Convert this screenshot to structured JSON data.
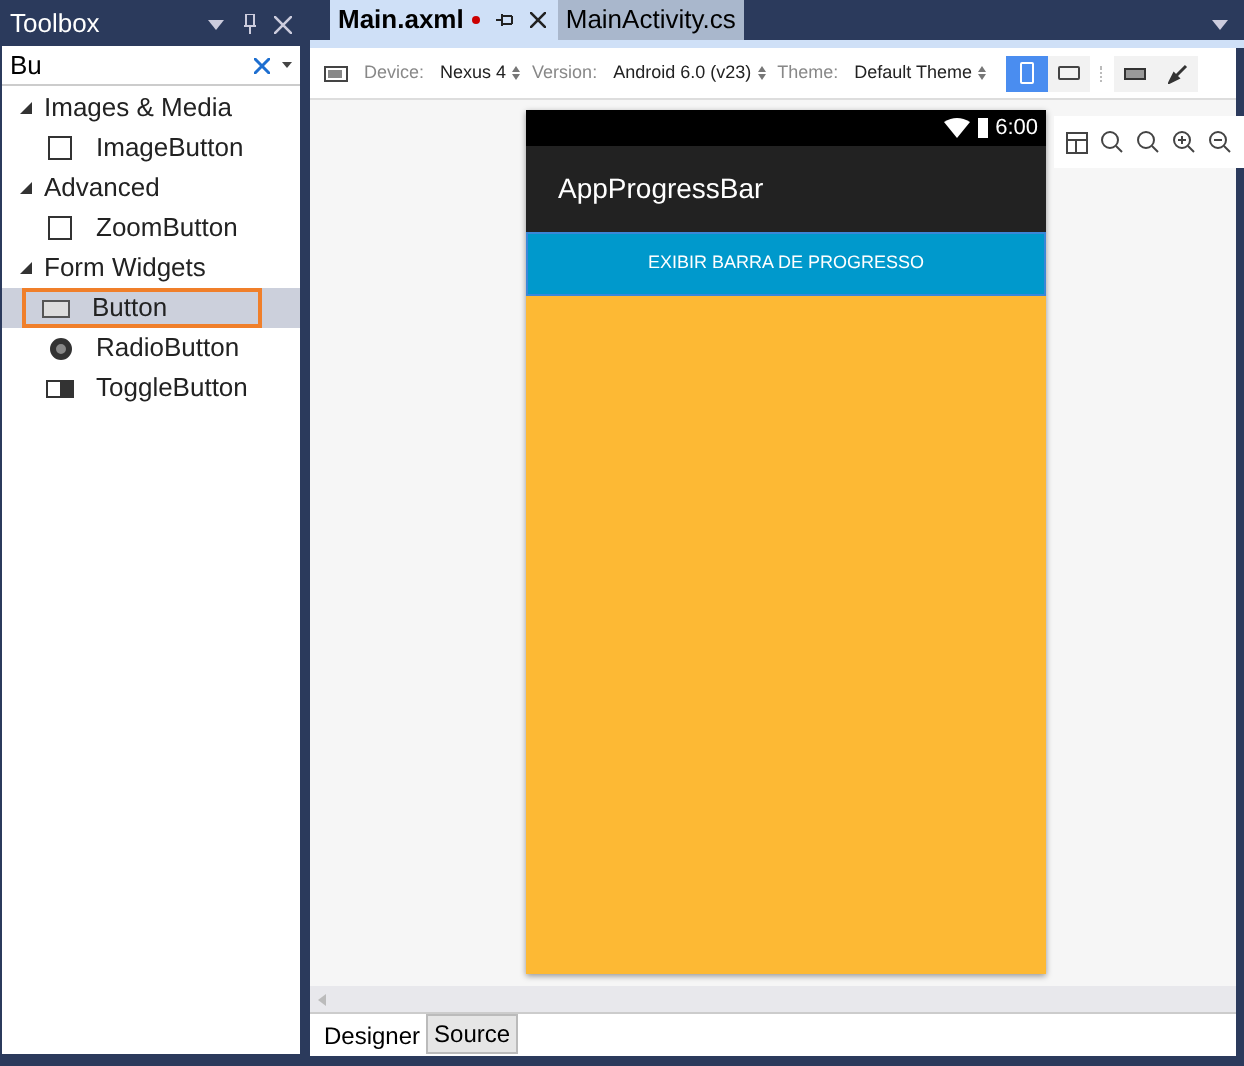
{
  "toolbox": {
    "title": "Toolbox",
    "search": "Bu",
    "groups": [
      {
        "label": "Images & Media",
        "expanded": true,
        "items": [
          {
            "label": "ImageButton",
            "kind": "plain",
            "selected": false
          }
        ]
      },
      {
        "label": "Advanced",
        "expanded": true,
        "items": [
          {
            "label": "ZoomButton",
            "kind": "plain",
            "selected": false
          }
        ]
      },
      {
        "label": "Form Widgets",
        "expanded": true,
        "items": [
          {
            "label": "Button",
            "kind": "button",
            "selected": true
          },
          {
            "label": "RadioButton",
            "kind": "radio",
            "selected": false
          },
          {
            "label": "ToggleButton",
            "kind": "toggle",
            "selected": false
          }
        ]
      }
    ]
  },
  "tabs": [
    {
      "label": "Main.axml",
      "selected": true,
      "modified": true
    },
    {
      "label": "MainActivity.cs",
      "selected": false,
      "modified": false
    }
  ],
  "toolbar": {
    "fields": [
      {
        "label": "Device:",
        "value": "Nexus 4"
      },
      {
        "label": "Version:",
        "value": "Android 6.0 (v23)"
      },
      {
        "label": "Theme:",
        "value": "Default Theme"
      }
    ],
    "orientation": [
      {
        "kind": "portrait",
        "selected": true
      },
      {
        "kind": "landscape",
        "selected": false
      }
    ]
  },
  "phone": {
    "time": "6:00",
    "app_title": "AppProgressBar",
    "button": "EXIBIR BARRA DE PROGRESSO"
  },
  "bottom_tabs": [
    {
      "label": "Designer",
      "selected": true
    },
    {
      "label": "Source",
      "selected": false
    }
  ]
}
